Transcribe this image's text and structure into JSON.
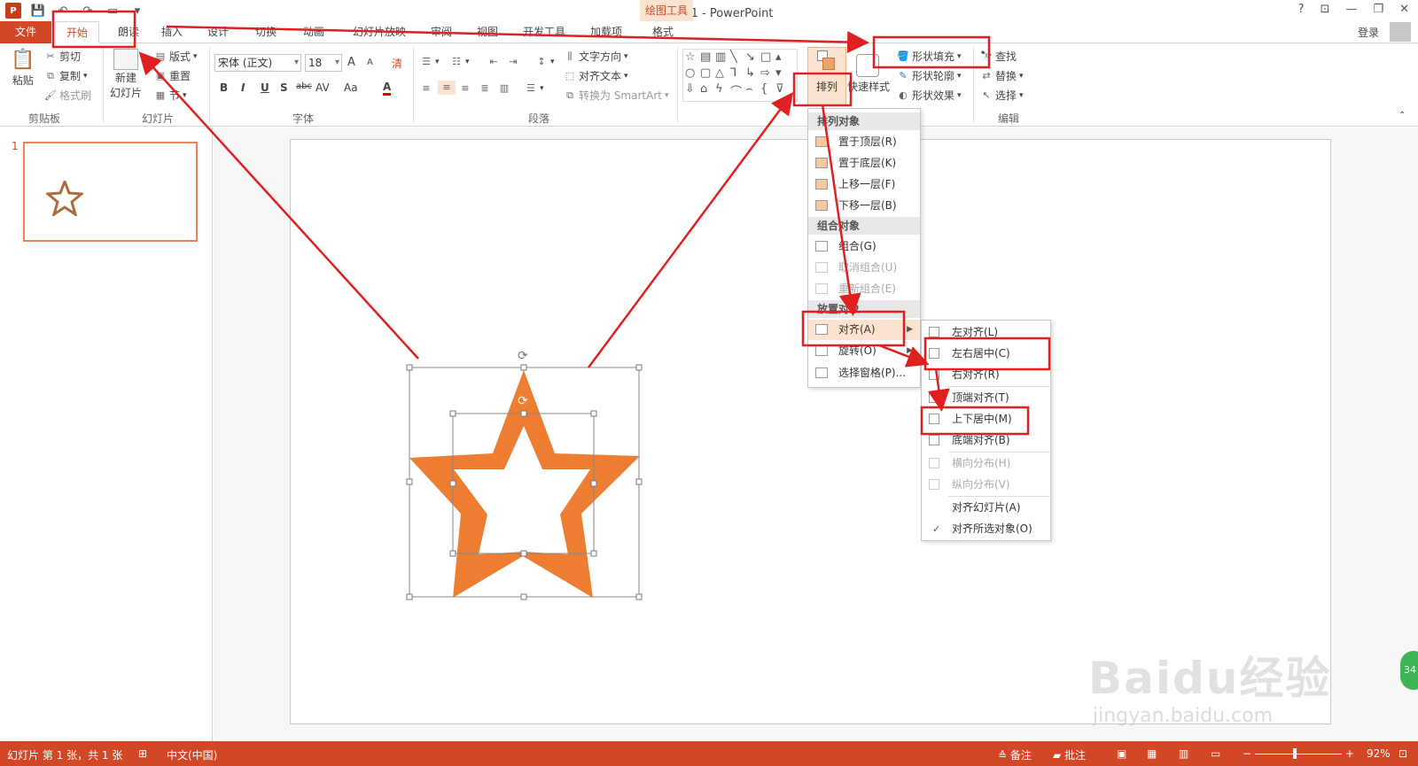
{
  "titlebar": {
    "logo": "P",
    "title": "演示文稿1 - PowerPoint",
    "context_tab_group": "绘图工具",
    "help": "?",
    "restore_ribbon": "⊡",
    "minimize": "—",
    "maximize": "❐",
    "close": "✕"
  },
  "tabs": {
    "file": "文件",
    "home": "开始",
    "read": "朗读",
    "insert": "插入",
    "design": "设计",
    "transitions": "切换",
    "animations": "动画",
    "slideshow": "幻灯片放映",
    "review": "审阅",
    "view": "视图",
    "developer": "开发工具",
    "addins": "加载项",
    "format": "格式"
  },
  "account": {
    "login": "登录"
  },
  "ribbon": {
    "clipboard": {
      "label": "剪贴板",
      "paste": "粘贴",
      "cut": "剪切",
      "copy": "复制",
      "format_painter": "格式刷"
    },
    "slides": {
      "label": "幻灯片",
      "new_slide_line1": "新建",
      "new_slide_line2": "幻灯片",
      "layout": "版式",
      "reset": "重置",
      "section": "节"
    },
    "font": {
      "label": "字体",
      "font_name": "宋体 (正文)",
      "font_size": "18",
      "grow": "A",
      "shrink": "A",
      "clear": "清",
      "bold": "B",
      "italic": "I",
      "underline": "U",
      "shadow": "S",
      "strike": "abc",
      "spacing": "AV",
      "case": "Aa",
      "color": "A"
    },
    "paragraph": {
      "label": "段落",
      "text_direction": "文字方向",
      "align_text": "对齐文本",
      "smartart": "转换为 SmartArt"
    },
    "drawing": {
      "arrange": "排列",
      "quick_styles": "快速样式",
      "shape_fill": "形状填充",
      "shape_outline": "形状轮廓",
      "shape_effects": "形状效果"
    },
    "editing": {
      "label": "编辑",
      "find": "查找",
      "replace": "替换",
      "select": "选择"
    }
  },
  "thumbnails": {
    "slide_number": "1"
  },
  "arrange_menu": {
    "header_order": "排列对象",
    "bring_to_front": "置于顶层(R)",
    "send_to_back": "置于底层(K)",
    "bring_forward": "上移一层(F)",
    "send_backward": "下移一层(B)",
    "header_group": "组合对象",
    "group": "组合(G)",
    "ungroup": "取消组合(U)",
    "regroup": "重新组合(E)",
    "header_position": "放置对象",
    "align": "对齐(A)",
    "rotate": "旋转(O)",
    "selection_pane": "选择窗格(P)..."
  },
  "align_menu": {
    "left": "左对齐(L)",
    "center": "左右居中(C)",
    "right": "右对齐(R)",
    "top": "顶端对齐(T)",
    "middle": "上下居中(M)",
    "bottom": "底端对齐(B)",
    "distribute_h": "横向分布(H)",
    "distribute_v": "纵向分布(V)",
    "to_slide": "对齐幻灯片(A)",
    "to_selected": "对齐所选对象(O)",
    "check": "✓"
  },
  "statusbar": {
    "slide_info": "幻灯片 第 1 张，共 1 张",
    "language": "中文(中国)",
    "notes": "备注",
    "comments": "批注",
    "zoom": "92%"
  },
  "watermark": {
    "brand": "Baidu经验",
    "url": "jingyan.baidu.com",
    "badge": "34"
  },
  "colors": {
    "accent": "#d24726",
    "star_fill": "#ed7d31",
    "highlight": "#fbe3cf",
    "annotation": "#e02020"
  },
  "icons": {
    "save": "save-icon",
    "undo": "undo-icon",
    "redo": "redo-icon",
    "cut": "scissors-icon",
    "copy": "copy-icon",
    "paste": "clipboard-icon",
    "find": "binoculars-icon",
    "replace": "replace-icon",
    "select": "cursor-icon"
  }
}
